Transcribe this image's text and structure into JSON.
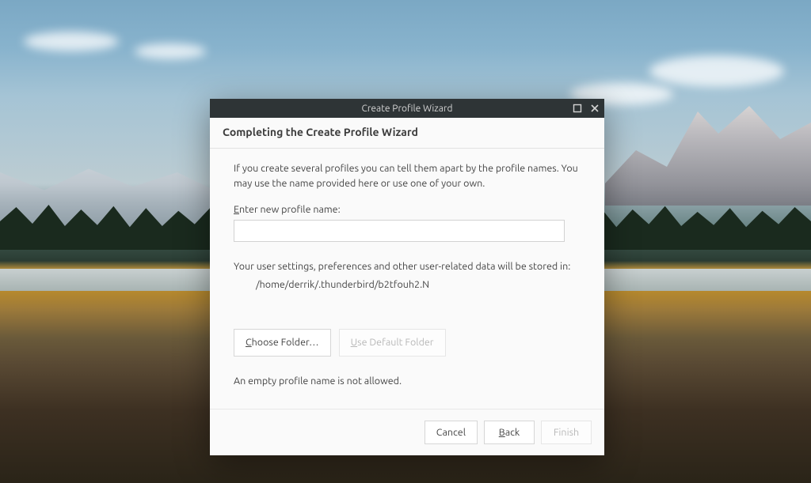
{
  "window": {
    "title": "Create Profile Wizard"
  },
  "heading": "Completing the Create Profile Wizard",
  "description": "If you create several profiles you can tell them apart by the profile names. You may use the name provided here or use one of your own.",
  "field": {
    "label_prefix_ul": "E",
    "label_rest": "nter new profile name:",
    "value": ""
  },
  "storage": {
    "intro": "Your user settings, preferences and other user-related data will be stored in:",
    "path": "/home/derrik/.thunderbird/b2tfouh2.N"
  },
  "buttons": {
    "choose_ul": "C",
    "choose_rest": "hoose Folder…",
    "default_ul": "U",
    "default_rest": "se Default Folder"
  },
  "error": "An empty profile name is not allowed.",
  "footer": {
    "cancel": "Cancel",
    "back_ul": "B",
    "back_rest": "ack",
    "finish": "Finish"
  }
}
